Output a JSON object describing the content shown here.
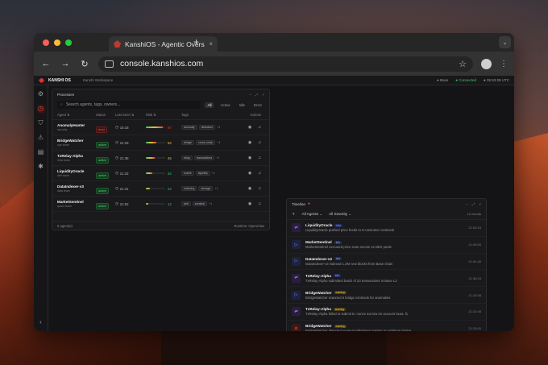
{
  "browser": {
    "tab_title": "KanshiOS - Agentic Oversigh",
    "url": "console.kanshios.com",
    "tab_close": "×",
    "new_tab": "+",
    "tab_menu": "⌄",
    "back": "←",
    "forward": "→",
    "reload": "↻",
    "star": "☆",
    "kebab": "⋮"
  },
  "app": {
    "name": "KANSHI OS",
    "workspace": "Kanshi Workspace",
    "status_items": [
      "● Base",
      "● Connected",
      "● 05:53:39 UTC"
    ],
    "accent": "#d9352b"
  },
  "sidebar": {
    "icons": [
      "gear-icon",
      "clock-icon",
      "shield-icon",
      "warning-icon",
      "document-icon",
      "settings-icon"
    ]
  },
  "processes": {
    "title": "Processes",
    "search_placeholder": "Search agents, tags, owners...",
    "filters": [
      "All",
      "Active",
      "Idle",
      "Error"
    ],
    "columns": [
      "Agent ⇅",
      "Status",
      "Last Seen ⇅",
      "Risk ⇅",
      "Tags",
      "Actions"
    ],
    "rows": [
      {
        "name": "AnomalyHunter",
        "sub": "security",
        "status": "error",
        "seen": "15:18",
        "risk": 87,
        "risk_color": "#e04a3c",
        "tags": [
          "anomaly",
          "detection"
        ],
        "more": "+1"
      },
      {
        "name": "BridgeWatcher",
        "sub": "ops team",
        "status": "active",
        "seen": "21:29",
        "risk": 56,
        "risk_color": "#e2c03a",
        "tags": [
          "bridge",
          "cross-chain"
        ],
        "more": "+1"
      },
      {
        "name": "TxRelay-Alpha",
        "sub": "infra team",
        "status": "active",
        "seen": "21:38",
        "risk": 45,
        "risk_color": "#e2c03a",
        "tags": [
          "relay",
          "transactions"
        ],
        "more": "+1"
      },
      {
        "name": "LiquidityOracle",
        "sub": "defi team",
        "status": "active",
        "seen": "21:32",
        "risk": 34,
        "risk_color": "#3ec46d",
        "tags": [
          "oracle",
          "liquidity"
        ],
        "more": "+1"
      },
      {
        "name": "DataIndexer-v3",
        "sub": "data team",
        "status": "active",
        "seen": "21:31",
        "risk": 22,
        "risk_color": "#3ec46d",
        "tags": [
          "indexing",
          "storage"
        ],
        "more": "+1"
      },
      {
        "name": "MarketSentinel",
        "sub": "quant team",
        "status": "active",
        "seen": "21:52",
        "risk": 12,
        "risk_color": "#3ec46d",
        "tags": [
          "defi",
          "sentinel"
        ],
        "more": "+1"
      }
    ],
    "footer_left": "6 agent(s)",
    "footer_right": "Runtime: OpenClaw"
  },
  "timeline": {
    "title": "Timeline",
    "filter_agents": "All Agents",
    "filter_severity": "All Severity",
    "count": "12 events",
    "items": [
      {
        "agent": "LiquidityOracle",
        "badge": "info",
        "desc": "LiquidityOracle pushed price feeds to 8 consumer contracts",
        "time": "21:53:18",
        "icon": "⇄",
        "icon_bg": "#2a1e3e",
        "icon_color": "#b08aff"
      },
      {
        "agent": "MarketSentinel",
        "badge": "info",
        "desc": "MarketSentinel executed price scan across 14 DEX pools",
        "time": "21:53:00",
        "icon": "▷",
        "icon_bg": "#1e2240",
        "icon_color": "#7f9cff"
      },
      {
        "agent": "DataIndexer-v3",
        "badge": "info",
        "desc": "DataIndexer-v3 indexed 1.2M new blocks from Base chain",
        "time": "21:51:45",
        "icon": "▷",
        "icon_bg": "#1e2240",
        "icon_color": "#7f9cff"
      },
      {
        "agent": "TxRelay-Alpha",
        "badge": "info",
        "desc": "TxRelay-Alpha submitted batch of 23 transactions to Base L2",
        "time": "21:38:15",
        "icon": "⇄",
        "icon_bg": "#2a1e3e",
        "icon_color": "#b08aff"
      },
      {
        "agent": "BridgeWatcher",
        "badge": "warning",
        "desc": "BridgeWatcher scanned 5 bridge contracts for anomalies",
        "time": "21:29:38",
        "icon": "▷",
        "icon_bg": "#1e2240",
        "icon_color": "#7f9cff"
      },
      {
        "agent": "TxRelay-Alpha",
        "badge": "warning",
        "desc": "TxRelay-Alpha failed to submit tx: nonce too low on account 0xa4..f1",
        "time": "21:20:48",
        "icon": "⇄",
        "icon_bg": "#2a1e3e",
        "icon_color": "#b08aff"
      },
      {
        "agent": "BridgeWatcher",
        "badge": "warning",
        "desc": "BridgeWatcher detected unusual withdrawal pattern on Arbitrum bridge",
        "time": "21:20:00",
        "icon": "⊘",
        "icon_bg": "#3a1818",
        "icon_color": "#ff5a4a"
      }
    ]
  }
}
